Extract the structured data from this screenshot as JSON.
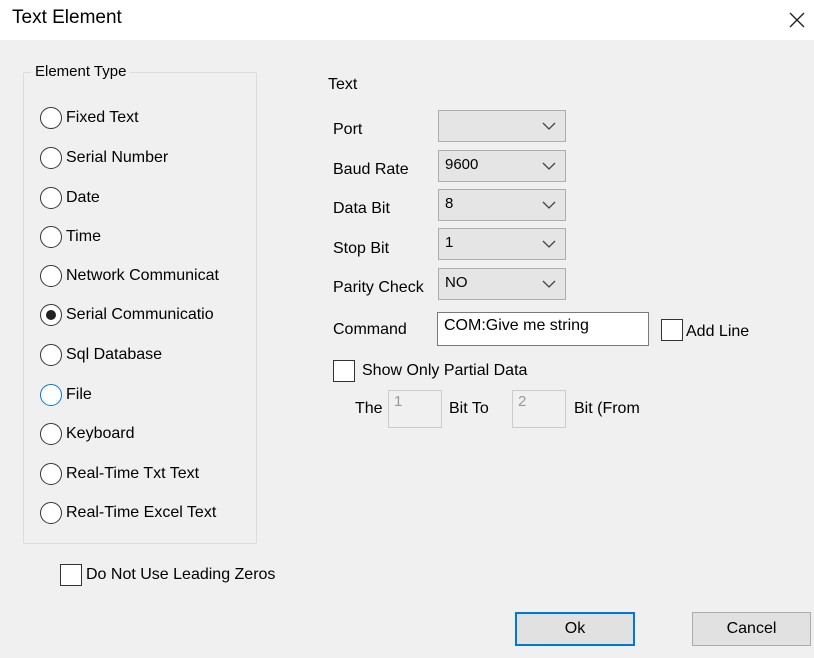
{
  "window": {
    "title": "Text Element"
  },
  "element_type": {
    "legend": "Element Type",
    "options": [
      {
        "label": "Fixed Text",
        "selected": false
      },
      {
        "label": "Serial Number",
        "selected": false
      },
      {
        "label": "Date",
        "selected": false
      },
      {
        "label": "Time",
        "selected": false
      },
      {
        "label": "Network Communicat",
        "selected": false
      },
      {
        "label": "Serial Communicatio",
        "selected": true
      },
      {
        "label": "Sql Database",
        "selected": false
      },
      {
        "label": "File",
        "selected": false
      },
      {
        "label": "Keyboard",
        "selected": false
      },
      {
        "label": "Real-Time Txt Text",
        "selected": false
      },
      {
        "label": "Real-Time Excel Text",
        "selected": false
      }
    ]
  },
  "text_section": {
    "heading": "Text",
    "port": {
      "label": "Port",
      "value": ""
    },
    "baud_rate": {
      "label": "Baud Rate",
      "value": "9600"
    },
    "data_bit": {
      "label": "Data Bit",
      "value": "8"
    },
    "stop_bit": {
      "label": "Stop Bit",
      "value": "1"
    },
    "parity_check": {
      "label": "Parity Check",
      "value": "NO"
    },
    "command": {
      "label": "Command",
      "value": "COM:Give me string"
    },
    "add_line": {
      "label": "Add Line",
      "checked": false
    },
    "partial": {
      "label": "Show Only Partial Data",
      "checked": false,
      "the_label": "The",
      "from_value": "1",
      "bit_to_label": "Bit To",
      "to_value": "2",
      "bit_from_label": "Bit (From"
    }
  },
  "leading_zeros": {
    "label": "Do Not Use Leading Zeros",
    "checked": false
  },
  "buttons": {
    "ok": "Ok",
    "cancel": "Cancel"
  }
}
